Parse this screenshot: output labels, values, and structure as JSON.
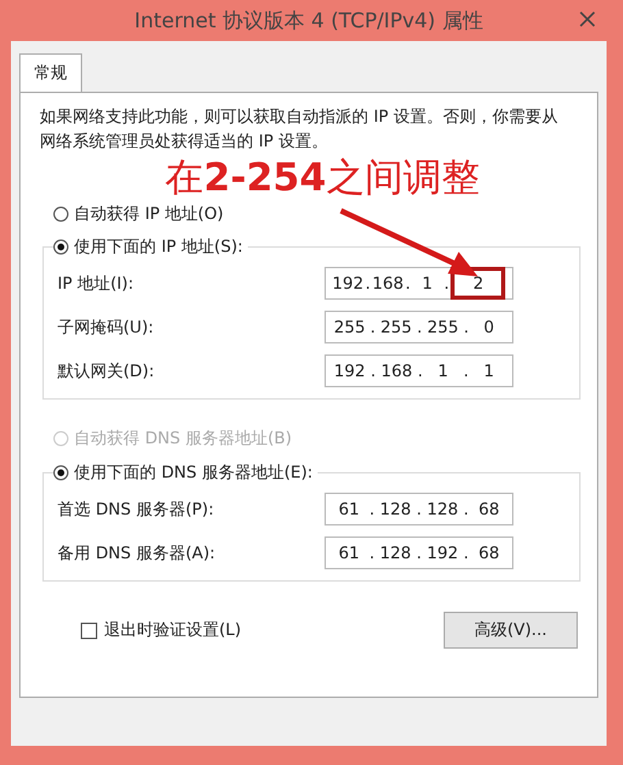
{
  "window": {
    "title": "Internet 协议版本 4 (TCP/IPv4) 属性"
  },
  "tabs": [
    {
      "label": "常规",
      "selected": true
    }
  ],
  "description": "如果网络支持此功能，则可以获取自动指派的 IP 设置。否则，你需要从网络系统管理员处获得适当的 IP 设置。",
  "annotation": "在**2-254**之间调整",
  "ip_mode": [
    {
      "label": "自动获得 IP 地址(O)",
      "selected": false,
      "disabled": false
    },
    {
      "label": "使用下面的 IP 地址(S):",
      "selected": true,
      "disabled": false
    }
  ],
  "ip_fields": [
    {
      "label": "IP 地址(I):",
      "separator": ".",
      "octets": [
        {
          "text": "192",
          "marked": false
        },
        {
          "text": "168",
          "marked": false
        },
        {
          "text": "1",
          "marked": false
        },
        {
          "text": "2",
          "marked": true
        }
      ]
    },
    {
      "label": "子网掩码(U):",
      "separator": ".",
      "octets": [
        {
          "text": "255",
          "marked": false
        },
        {
          "text": "255",
          "marked": false
        },
        {
          "text": "255",
          "marked": false
        },
        {
          "text": "0",
          "marked": false
        }
      ]
    },
    {
      "label": "默认网关(D):",
      "separator": ".",
      "octets": [
        {
          "text": "192",
          "marked": false
        },
        {
          "text": "168",
          "marked": false
        },
        {
          "text": "1",
          "marked": false
        },
        {
          "text": "1",
          "marked": false
        }
      ]
    }
  ],
  "dns_mode": [
    {
      "label": "自动获得 DNS 服务器地址(B)",
      "selected": false,
      "disabled": true
    },
    {
      "label": "使用下面的 DNS 服务器地址(E):",
      "selected": true,
      "disabled": false
    }
  ],
  "dns_fields": [
    {
      "label": "首选 DNS 服务器(P):",
      "separator": ".",
      "octets": [
        {
          "text": "61",
          "marked": false
        },
        {
          "text": "128",
          "marked": false
        },
        {
          "text": "128",
          "marked": false
        },
        {
          "text": "68",
          "marked": false
        }
      ]
    },
    {
      "label": "备用 DNS 服务器(A):",
      "separator": ".",
      "octets": [
        {
          "text": "61",
          "marked": false
        },
        {
          "text": "128",
          "marked": false
        },
        {
          "text": "192",
          "marked": false
        },
        {
          "text": "68",
          "marked": false
        }
      ]
    }
  ],
  "validate_checkbox": {
    "label": "退出时验证设置(L)",
    "checked": false
  },
  "advanced_button": "高级(V)..."
}
